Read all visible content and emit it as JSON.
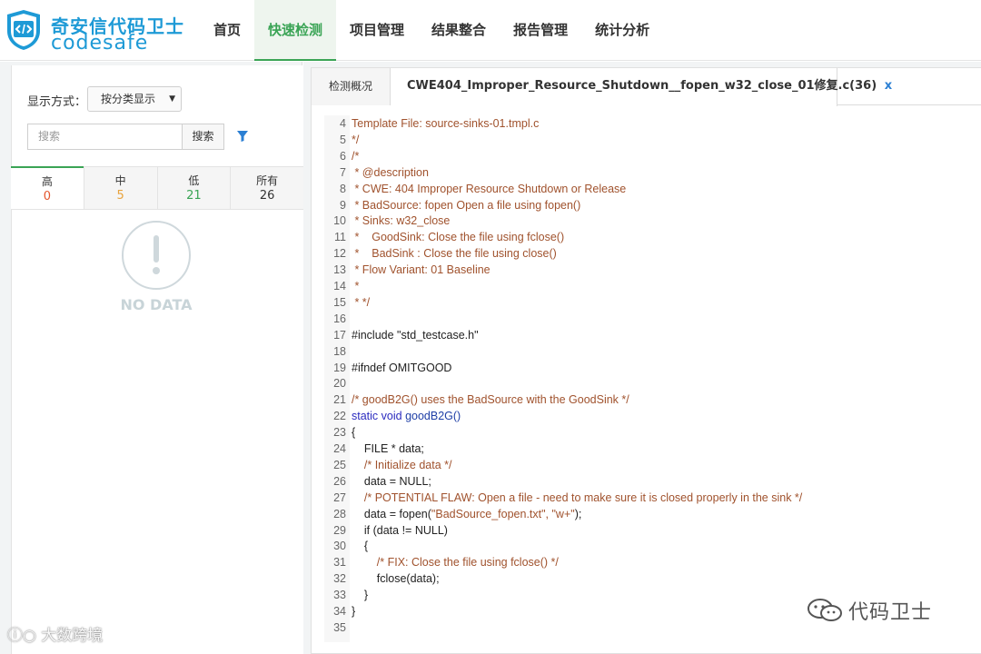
{
  "logo": {
    "cn": "奇安信代码卫士",
    "en": "codesafe"
  },
  "nav": [
    {
      "label": "首页"
    },
    {
      "label": "快速检测",
      "active": true
    },
    {
      "label": "项目管理"
    },
    {
      "label": "结果整合"
    },
    {
      "label": "报告管理"
    },
    {
      "label": "统计分析"
    }
  ],
  "left": {
    "display_label": "显示方式：",
    "display_value": "按分类显示",
    "search_placeholder": "搜索",
    "search_button": "搜索",
    "severity_tabs": [
      {
        "label": "高",
        "count": "0",
        "color": "#e4572e"
      },
      {
        "label": "中",
        "count": "5",
        "color": "#e8a33d"
      },
      {
        "label": "低",
        "count": "21",
        "color": "#3aa455"
      },
      {
        "label": "所有",
        "count": "26",
        "color": "#333333"
      }
    ],
    "nodata_text": "NO DATA"
  },
  "tabs": {
    "overview": "检测概况",
    "file": "CWE404_Improper_Resource_Shutdown__fopen_w32_close_01修复.c(36)",
    "close": "x"
  },
  "code_lines": [
    {
      "n": "4",
      "t": "Template File: source-sinks-01.tmpl.c",
      "c": "comment"
    },
    {
      "n": "5",
      "t": "*/",
      "c": "comment"
    },
    {
      "n": "6",
      "t": "/*",
      "c": "comment"
    },
    {
      "n": "7",
      "t": " * @description",
      "c": "comment"
    },
    {
      "n": "8",
      "t": " * CWE: 404 Improper Resource Shutdown or Release",
      "c": "comment"
    },
    {
      "n": "9",
      "t": " * BadSource: fopen Open a file using fopen()",
      "c": "comment"
    },
    {
      "n": "10",
      "t": " * Sinks: w32_close",
      "c": "comment"
    },
    {
      "n": "11",
      "t": " *    GoodSink: Close the file using fclose()",
      "c": "comment"
    },
    {
      "n": "12",
      "t": " *    BadSink : Close the file using close()",
      "c": "comment"
    },
    {
      "n": "13",
      "t": " * Flow Variant: 01 Baseline",
      "c": "comment"
    },
    {
      "n": "14",
      "t": " *",
      "c": "comment"
    },
    {
      "n": "15",
      "t": " * */",
      "c": "comment"
    },
    {
      "n": "16",
      "t": "",
      "c": "plain"
    },
    {
      "n": "17",
      "t": "#include \"std_testcase.h\"",
      "c": "plain"
    },
    {
      "n": "18",
      "t": "",
      "c": "plain"
    },
    {
      "n": "19",
      "t": "#ifndef OMITGOOD",
      "c": "plain"
    },
    {
      "n": "20",
      "t": "",
      "c": "plain"
    },
    {
      "n": "21",
      "t": "/* goodB2G() uses the BadSource with the GoodSink */",
      "c": "comment"
    },
    {
      "n": "22",
      "t": "static void goodB2G()",
      "c": "kw"
    },
    {
      "n": "23",
      "t": "{",
      "c": "plain"
    },
    {
      "n": "24",
      "t": "    FILE * data;",
      "c": "plain"
    },
    {
      "n": "25",
      "t": "    /* Initialize data */",
      "c": "comment"
    },
    {
      "n": "26",
      "t": "    data = NULL;",
      "c": "plain"
    },
    {
      "n": "27",
      "t": "    /* POTENTIAL FLAW: Open a file - need to make sure it is closed properly in the sink */",
      "c": "comment"
    },
    {
      "n": "28",
      "t": "    data = fopen(\"BadSource_fopen.txt\", \"w+\");",
      "c": "plain"
    },
    {
      "n": "29",
      "t": "    if (data != NULL)",
      "c": "plain"
    },
    {
      "n": "30",
      "t": "    {",
      "c": "plain"
    },
    {
      "n": "31",
      "t": "        /* FIX: Close the file using fclose() */",
      "c": "comment"
    },
    {
      "n": "32",
      "t": "        fclose(data);",
      "c": "plain"
    },
    {
      "n": "33",
      "t": "    }",
      "c": "plain"
    },
    {
      "n": "34",
      "t": "}",
      "c": "plain"
    },
    {
      "n": "35",
      "t": "",
      "c": "plain"
    }
  ],
  "watermarks": {
    "left": "大数跨境",
    "right": "代码卫士"
  }
}
